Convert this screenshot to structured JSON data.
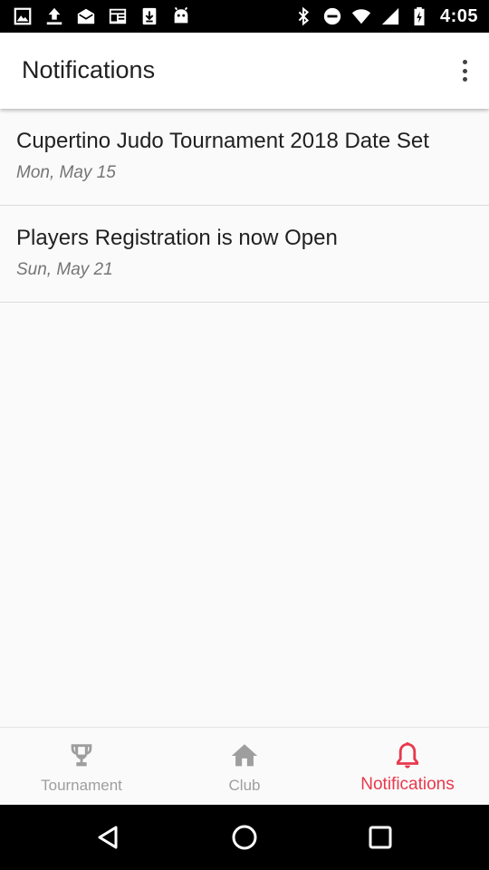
{
  "status_bar": {
    "time": "4:05",
    "left_icons": [
      "image-icon",
      "upload-icon",
      "mail-icon",
      "news-icon",
      "download-icon",
      "android-icon"
    ],
    "right_icons": [
      "bluetooth-icon",
      "do-not-disturb-icon",
      "wifi-icon",
      "cell-signal-icon",
      "battery-charging-icon"
    ]
  },
  "app_bar": {
    "title": "Notifications",
    "menu_icon": "more-vert-icon"
  },
  "notifications": [
    {
      "title": "Cupertino Judo Tournament 2018 Date Set",
      "date": "Mon, May 15"
    },
    {
      "title": "Players Registration is now Open",
      "date": "Sun, May 21"
    }
  ],
  "bottom_nav": {
    "tabs": [
      {
        "label": "Tournament",
        "icon": "trophy-icon",
        "active": false
      },
      {
        "label": "Club",
        "icon": "home-icon",
        "active": false
      },
      {
        "label": "Notifications",
        "icon": "bell-icon",
        "active": true
      }
    ],
    "active_color": "#e8394c",
    "inactive_color": "#9e9e9e"
  },
  "system_nav": {
    "buttons": [
      "back-icon",
      "home-circle-icon",
      "recents-icon"
    ]
  }
}
